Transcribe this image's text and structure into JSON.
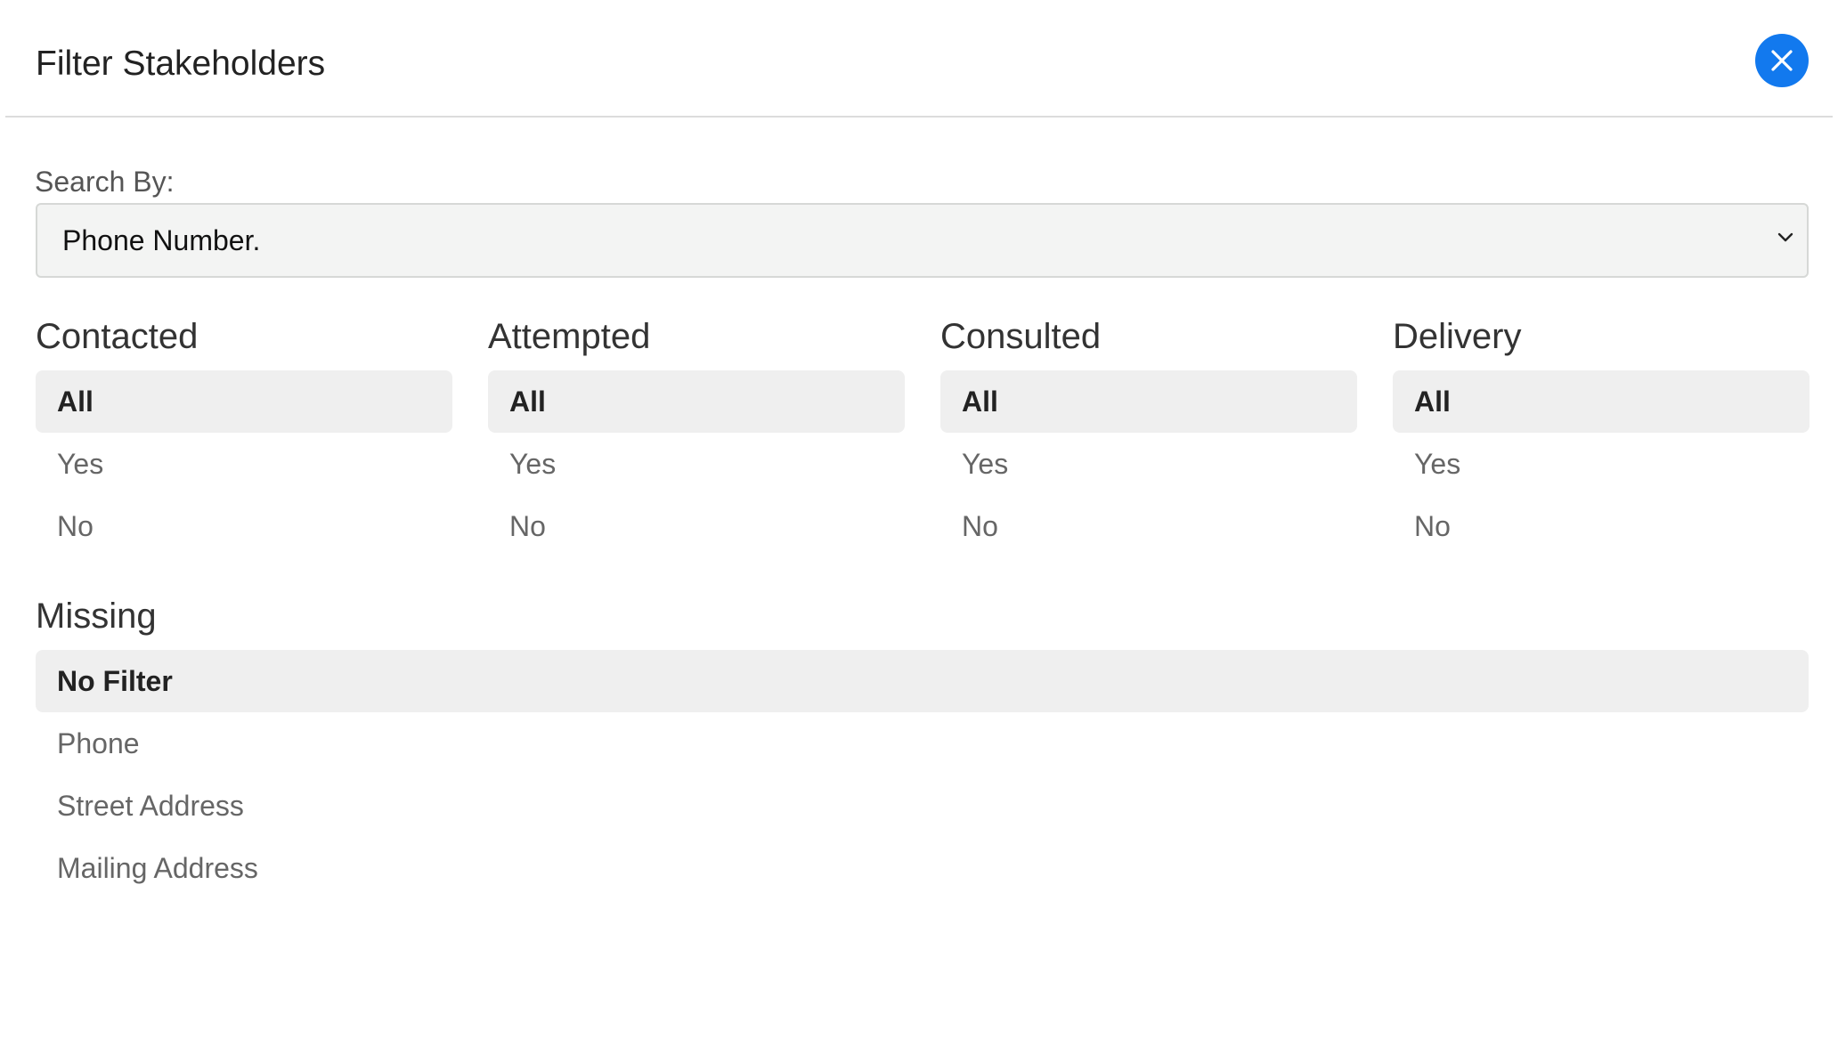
{
  "modal": {
    "title": "Filter Stakeholders",
    "close_icon": "close-icon",
    "accent_color": "#1279ee"
  },
  "search": {
    "label": "Search By:",
    "selected": "Phone Number.",
    "chevron_icon": "chevron-down-icon"
  },
  "filters": [
    {
      "title": "Contacted",
      "options": [
        {
          "label": "All",
          "selected": true
        },
        {
          "label": "Yes",
          "selected": false
        },
        {
          "label": "No",
          "selected": false
        }
      ]
    },
    {
      "title": "Attempted",
      "options": [
        {
          "label": "All",
          "selected": true
        },
        {
          "label": "Yes",
          "selected": false
        },
        {
          "label": "No",
          "selected": false
        }
      ]
    },
    {
      "title": "Consulted",
      "options": [
        {
          "label": "All",
          "selected": true
        },
        {
          "label": "Yes",
          "selected": false
        },
        {
          "label": "No",
          "selected": false
        }
      ]
    },
    {
      "title": "Delivery",
      "options": [
        {
          "label": "All",
          "selected": true
        },
        {
          "label": "Yes",
          "selected": false
        },
        {
          "label": "No",
          "selected": false
        }
      ]
    }
  ],
  "missing": {
    "title": "Missing",
    "options": [
      {
        "label": "No Filter",
        "selected": true
      },
      {
        "label": "Phone",
        "selected": false
      },
      {
        "label": "Street Address",
        "selected": false
      },
      {
        "label": "Mailing Address",
        "selected": false
      }
    ]
  }
}
